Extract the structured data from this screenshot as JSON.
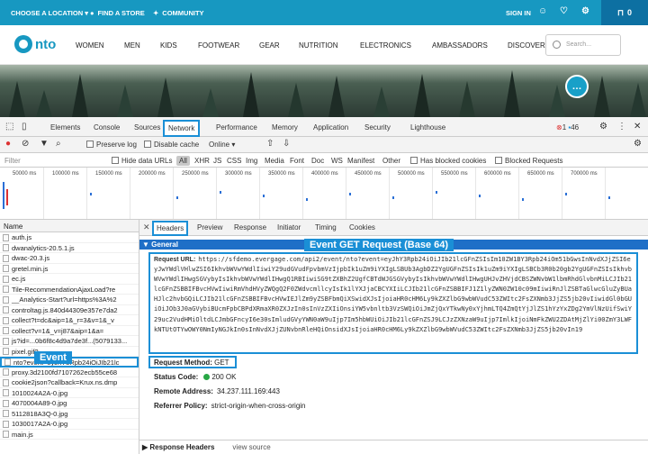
{
  "site": {
    "topbar": {
      "choose_location": "CHOOSE A LOCATION",
      "find_store": "FIND A STORE",
      "community": "COMMUNITY",
      "sign_in": "SIGN IN",
      "cart_count": "0"
    },
    "logo": "nto",
    "nav": [
      "WOMEN",
      "MEN",
      "KIDS",
      "FOOTWEAR",
      "GEAR",
      "NUTRITION",
      "ELECTRONICS",
      "AMBASSADORS",
      "DISCOVER"
    ],
    "search_placeholder": "Search..."
  },
  "devtools": {
    "tabs": [
      "Elements",
      "Console",
      "Sources",
      "Network",
      "Performance",
      "Memory",
      "Application",
      "Security",
      "Lighthouse"
    ],
    "active_tab": "Network",
    "errors": "1",
    "warnings": "46",
    "toolbar": {
      "preserve_log": "Preserve log",
      "disable_cache": "Disable cache",
      "throttle": "Online"
    },
    "filter": {
      "placeholder": "Filter",
      "hide_data_urls": "Hide data URLs",
      "types": [
        "All",
        "XHR",
        "JS",
        "CSS",
        "Img",
        "Media",
        "Font",
        "Doc",
        "WS",
        "Manifest",
        "Other"
      ],
      "blocked_cookies": "Has blocked cookies",
      "blocked_requests": "Blocked Requests"
    },
    "timeline_ticks": [
      "50000 ms",
      "100000 ms",
      "150000 ms",
      "200000 ms",
      "250000 ms",
      "300000 ms",
      "350000 ms",
      "400000 ms",
      "450000 ms",
      "500000 ms",
      "550000 ms",
      "600000 ms",
      "650000 ms",
      "700000 ms"
    ],
    "requests_header": "Name",
    "requests": [
      "auth.js",
      "dwanalytics-20.5.1.js",
      "dwac-20.3.js",
      "gretel.min.js",
      "ec.js",
      "Tile-RecommendationAjaxLoad?re",
      "__Analytics-Start?url=https%3A%2",
      "controltag.js.840d44309e357e7da2",
      "collect?t=dc&aip=1&_r=3&v=1&_v",
      "collect?v=1&_v=j87&aip=1&a=",
      "js?id=...0b6f8c4d9a7de3f...(5079133...",
      "pixel.gif?...",
      "nto?event=eyJhY3Rpb24iOiJIb21lc",
      "proxy.3d2100fd7107262ecb55ce68",
      "cookie2json?callback=Krux.ns.dmp",
      "1010024A2A-0.jpg",
      "4070004A89-0.jpg",
      "5112818A3Q-0.jpg",
      "1030017A2A-0.jpg",
      "main.js"
    ],
    "selected_request_index": 12,
    "detail_tabs": [
      "Headers",
      "Preview",
      "Response",
      "Initiator",
      "Timing",
      "Cookies"
    ],
    "active_detail_tab": "Headers",
    "general_title": "General",
    "request_url_label": "Request URL:",
    "request_url": "https://sfdemo.evergage.com/api2/event/nto?event=eyJhY3Rpb24iOiJIb21lcGFnZSIsIm10ZW1BY3Rpb24iOm51bGwsInNvdXJjZSI6eyJwYWdlVHlwZSI6IkhvbWVwYWdlIiwiY29udGVudFpvbmVzIjpbIk1uZm9iYXIgLSBUb3AgbDZ2YgUGFnZSIsIk1uZm9iYXIgLSBCb3R0b20gb2YgUGFnZSIsIkhvbWVwYWdlIHwgSGVybyIsIkhvbWVwYWdlIHwgQ1RBIiwiSG9tZXBhZ2UgfCBTdWJGSGVybyIsIkhvbWVwYWdlIHwgUHJvZHVjdCBSZWNvbW1lbmRhdGlvbnMiLCJIb21lcGFnZSBBIFBvcHVwIiwiRmVhdHVyZWQgQ2F0ZWdvcmllcyIsIk1lYXJjaCBCYXIiLCJIb21lcGFnZSBBIFJ1Z1lyZWN0ZW10c09mIiwiRnJlZSBTaGlwcGluZyBUaHJlc2hvbGQiLCJIb21lcGFnZSBBIFBvcHVwIEJlZm9yZSBFbmQiXSwidXJsIjoiaHR0cHM6Ly9kZXZlbG9wbWVudC53ZWItc2FsZXNmb3JjZS5jb20vIiwidGl0bGUiOiJOb3J0aGVybiBUcmFpbCBPdXRmaXR0ZXJzIn0sInVzZXIiOnsiYW5vbnltb3VzSWQiOiJmZjQxYTkwNy0xYjhmLTQ4ZmQtYjJlZS1hYzYxZDg2YmVlNzUifSwiY29uc2VudHMiOltdLCJmbGFncyI6e30sImludGVyYWN0aW9uIjp7Im5hbWUiOiJIb21lcGFnZSJ9LCJzZXNzaW9uIjp7ImlkIjoiNmFkZWU2ZDAtMjZlYi00ZmY3LWFkNTUtOTYwOWY0NmIyNGJkIn0sInNvdXJjZUNvbnRleHQiOnsidXJsIjoiaHR0cHM6Ly9kZXZlbG9wbWVudC53ZWItc2FsZXNmb3JjZS5jb20vIn19",
    "request_method_label": "Request Method:",
    "request_method": "GET",
    "status_code_label": "Status Code:",
    "status_code": "200 OK",
    "remote_address_label": "Remote Address:",
    "remote_address": "34.237.111.169:443",
    "referrer_policy_label": "Referrer Policy:",
    "referrer_policy": "strict-origin-when-cross-origin",
    "response_headers": "Response Headers",
    "view_source": "view source"
  },
  "annotations": {
    "event_get_request": "Event GET Request (Base 64)",
    "event": "Event"
  },
  "colors": {
    "brand": "#1798c1",
    "highlight": "#1a8fd6",
    "section_head": "#1f6fc7",
    "status_ok": "#28a745"
  }
}
